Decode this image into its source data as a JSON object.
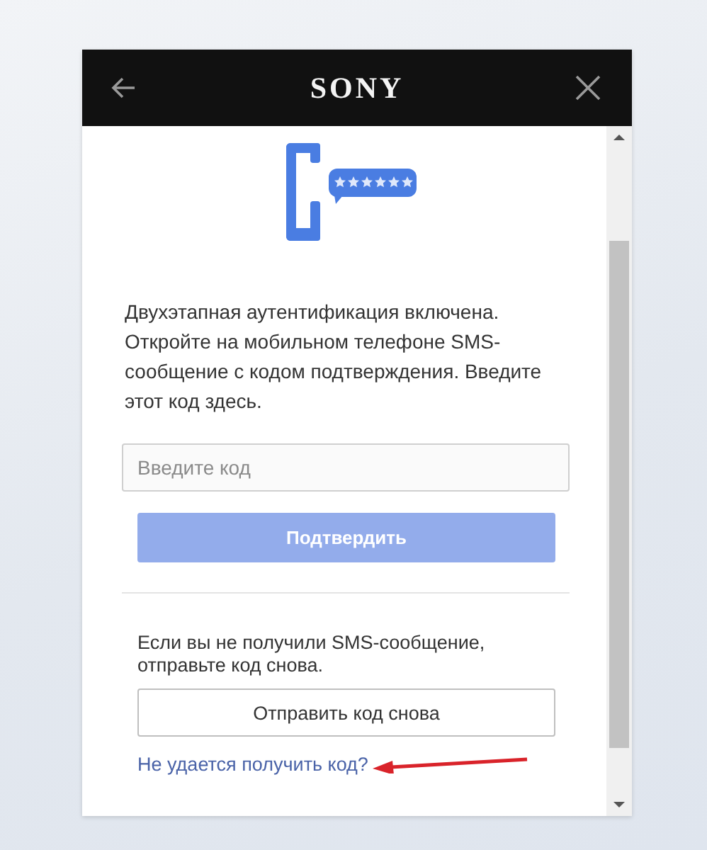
{
  "dialog": {
    "logo": "SONY"
  },
  "message": "Двухэтапная аутентификация включена. Откройте на мобильном телефоне SMS-сообщение с кодом подтверждения. Введите этот код здесь.",
  "code_field": {
    "placeholder": "Введите код"
  },
  "confirm_button": {
    "label": "Подтвердить",
    "disabled": true
  },
  "resend_note": "Если вы не получили SMS-сообщение, отправьте код снова.",
  "resend_button": {
    "label": "Отправить код снова",
    "disabled": false
  },
  "help_link": "Не удается получить код?"
}
